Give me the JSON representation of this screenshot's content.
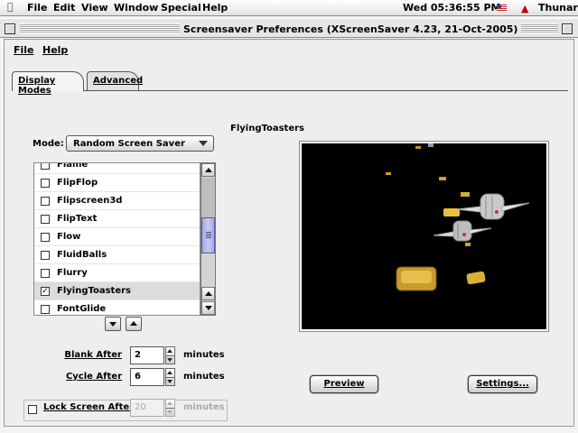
{
  "menubar": {
    "items": [
      "File",
      "Edit",
      "View",
      "Window",
      "Special",
      "Help"
    ],
    "clock": "Wed 05:36:55 PM",
    "app_name": "Thunar"
  },
  "window": {
    "title": "Screensaver Preferences  (XScreenSaver 4.23, 21-Oct-2005)"
  },
  "app_menu": [
    "File",
    "Help"
  ],
  "tabs": [
    "Display Modes",
    "Advanced"
  ],
  "mode": {
    "label": "Mode:",
    "value": "Random Screen Saver"
  },
  "hacks": [
    {
      "name": "Flame",
      "checked": false
    },
    {
      "name": "FlipFlop",
      "checked": false
    },
    {
      "name": "Flipscreen3d",
      "checked": false
    },
    {
      "name": "FlipText",
      "checked": false
    },
    {
      "name": "Flow",
      "checked": false
    },
    {
      "name": "FluidBalls",
      "checked": false
    },
    {
      "name": "Flurry",
      "checked": false
    },
    {
      "name": "FlyingToasters",
      "checked": true
    },
    {
      "name": "FontGlide",
      "checked": false
    }
  ],
  "selected_hack": "FlyingToasters",
  "blank_after": {
    "label": "Blank After",
    "value": "2",
    "unit": "minutes"
  },
  "cycle_after": {
    "label": "Cycle After",
    "value": "6",
    "unit": "minutes"
  },
  "lock_screen": {
    "label": "Lock Screen After",
    "value": "20",
    "unit": "minutes",
    "checked": false
  },
  "preview": {
    "title": "FlyingToasters"
  },
  "buttons": {
    "preview": "Preview",
    "settings": "Settings..."
  },
  "colors": {
    "selection": "#dcdcdc",
    "scroll_thumb": "#b9baf0",
    "preview_bg": "#000000"
  }
}
